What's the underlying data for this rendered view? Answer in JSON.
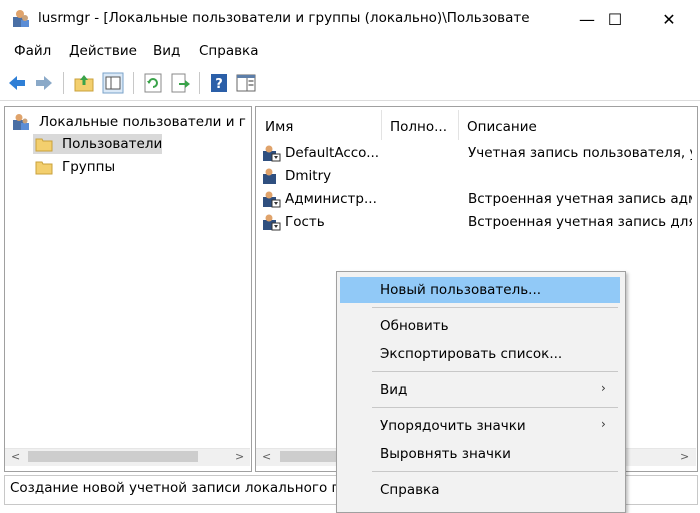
{
  "window": {
    "title": "lusrmgr - [Локальные пользователи и группы (локально)\\Пользовате",
    "min_glyph": "—",
    "max_glyph": "☐",
    "close_glyph": "✕"
  },
  "menu": [
    "Файл",
    "Действие",
    "Вид",
    "Справка"
  ],
  "toolbar": {
    "icons": [
      "back-arrow-icon",
      "forward-arrow-icon",
      "up-folder-icon",
      "show-hide-tree-icon",
      "refresh-icon",
      "export-list-icon",
      "help-icon",
      "action-pane-icon"
    ]
  },
  "tree": {
    "root": "Локальные пользователи и гр",
    "items": [
      "Пользователи",
      "Группы"
    ],
    "selected": "Пользователи"
  },
  "list": {
    "columns": [
      "Имя",
      "Полно...",
      "Описание"
    ],
    "rows": [
      {
        "name": "DefaultAcco...",
        "full": "",
        "desc": "Учетная запись пользователя, уп"
      },
      {
        "name": "Dmitry",
        "full": "",
        "desc": ""
      },
      {
        "name": "Администр...",
        "full": "",
        "desc": "Встроенная учетная запись адми"
      },
      {
        "name": "Гость",
        "full": "",
        "desc": "Встроенная учетная запись для д"
      }
    ]
  },
  "status": {
    "text": "Создание новой учетной записи локального по"
  },
  "context_menu": {
    "items": [
      {
        "label": "Новый пользователь...",
        "highlighted": true
      },
      {
        "label": "Обновить"
      },
      {
        "label": "Экспортировать список..."
      },
      {
        "label": "Вид",
        "submenu": true
      },
      {
        "label": "Упорядочить значки",
        "submenu": true
      },
      {
        "label": "Выровнять значки"
      },
      {
        "label": "Справка"
      }
    ],
    "arrow_glyph": "›"
  },
  "colors": {
    "highlight": "#91c9f7",
    "tree_selection": "#d9d9d9",
    "folder": "#f3cf6e"
  }
}
